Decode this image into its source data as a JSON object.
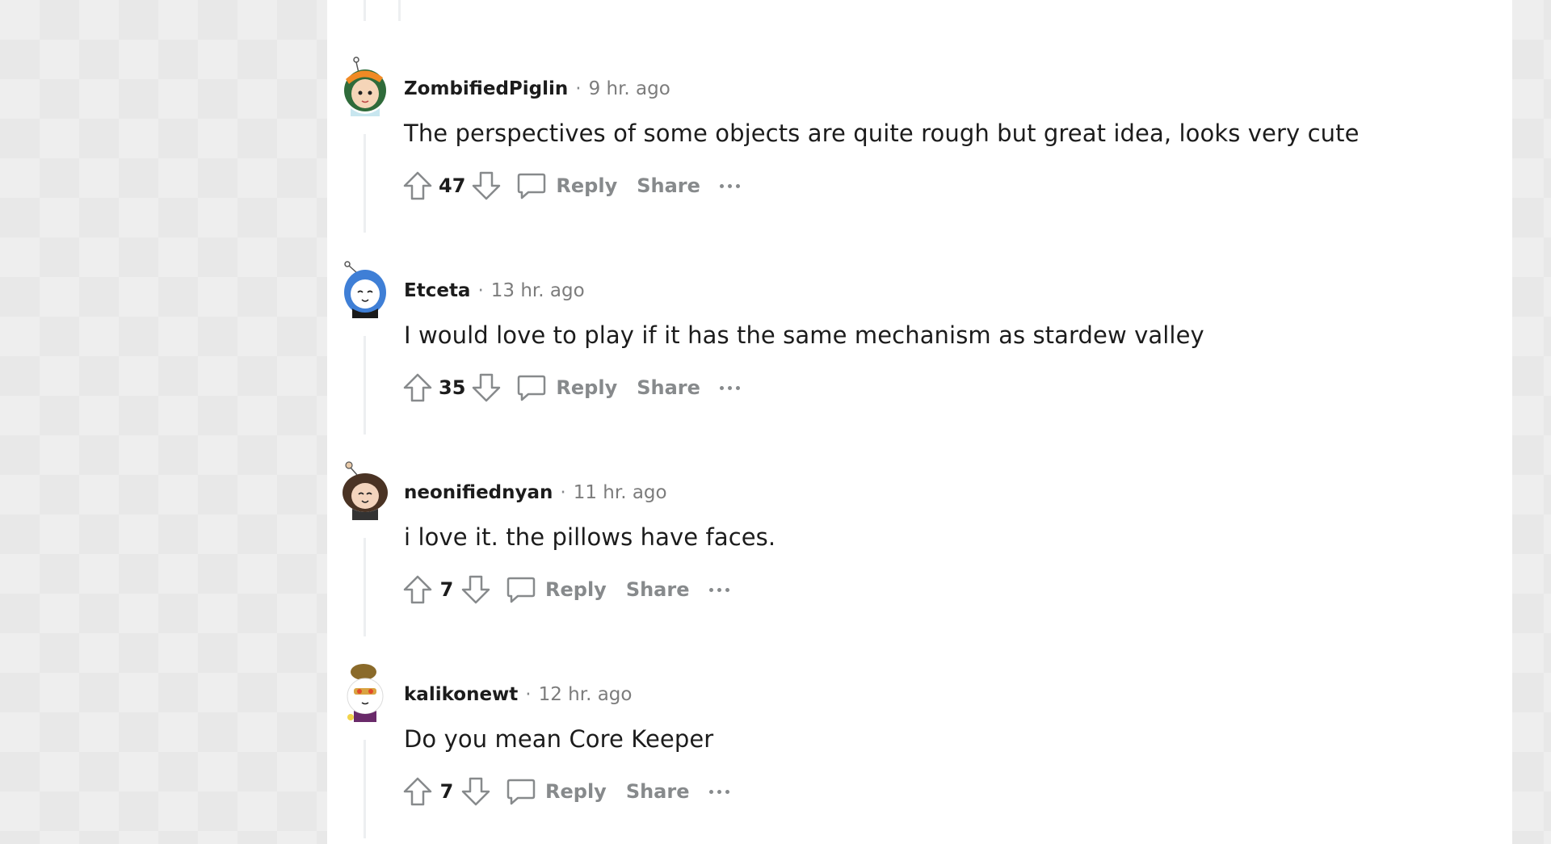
{
  "comments": [
    {
      "author": "ZombifiedPiglin",
      "separator": "·",
      "time": "9 hr. ago",
      "body": "The perspectives of some objects are quite rough but great idea, looks very cute",
      "score": "47",
      "reply_label": "Reply",
      "share_label": "Share",
      "avatar_colors": {
        "hair": "#2f6b3a",
        "hat": "#f08a24",
        "skin": "#f5d5b8"
      }
    },
    {
      "author": "Etceta",
      "separator": "·",
      "time": "13 hr. ago",
      "body": "I would love to play if it has the same mechanism as stardew valley",
      "score": "35",
      "reply_label": "Reply",
      "share_label": "Share",
      "avatar_colors": {
        "hair": "#3f7fd6",
        "hat": "#ffffff",
        "skin": "#ffffff"
      }
    },
    {
      "author": "neonifiednyan",
      "separator": "·",
      "time": "11 hr. ago",
      "body": "i love it. the pillows have faces.",
      "score": "7",
      "reply_label": "Reply",
      "share_label": "Share",
      "avatar_colors": {
        "hair": "#4a3324",
        "hat": "#ffffff",
        "skin": "#f3d4bd"
      }
    },
    {
      "author": "kalikonewt",
      "separator": "·",
      "time": "12 hr. ago",
      "body": "Do you mean Core Keeper",
      "score": "7",
      "reply_label": "Reply",
      "share_label": "Share",
      "avatar_colors": {
        "hair": "#8a6a2a",
        "hat": "#d9a441",
        "skin": "#ffffff"
      }
    }
  ],
  "icons": [
    "upvote-icon",
    "downvote-icon",
    "comment-icon",
    "more-options-icon"
  ],
  "colors": {
    "text": "#1c1c1c",
    "muted": "#878a8c",
    "thread": "#edeff1"
  }
}
